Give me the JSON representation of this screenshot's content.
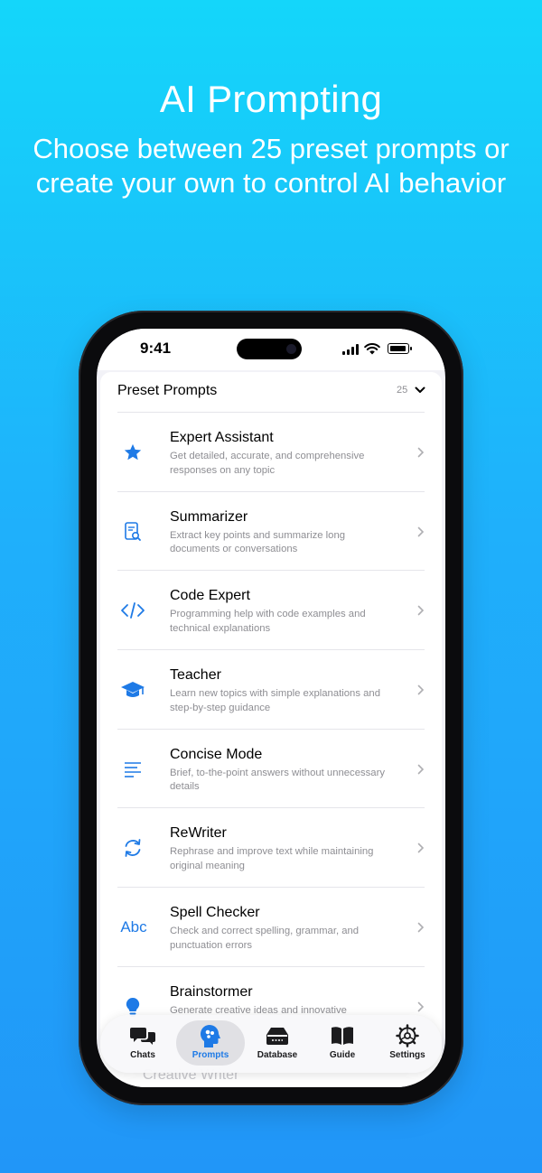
{
  "hero": {
    "title": "AI Prompting",
    "subtitle": "Choose between 25 preset prompts or create your own to control AI behavior"
  },
  "status_bar": {
    "time": "9:41"
  },
  "preset_section": {
    "title": "Preset Prompts",
    "count": "25"
  },
  "prompts": [
    {
      "icon": "star-icon",
      "name": "Expert Assistant",
      "description": "Get detailed, accurate, and comprehensive responses on any topic"
    },
    {
      "icon": "document-search-icon",
      "name": "Summarizer",
      "description": "Extract key points and summarize long documents or conversations"
    },
    {
      "icon": "code-brackets-icon",
      "name": "Code Expert",
      "description": "Programming help with code examples and technical explanations"
    },
    {
      "icon": "graduation-cap-icon",
      "name": "Teacher",
      "description": "Learn new topics with simple explanations and step-by-step guidance"
    },
    {
      "icon": "text-lines-icon",
      "name": "Concise Mode",
      "description": "Brief, to-the-point answers without unnecessary details"
    },
    {
      "icon": "rotate-arrows-icon",
      "name": "ReWriter",
      "description": "Rephrase and improve text while maintaining original meaning"
    },
    {
      "icon": "abc-text-icon",
      "name": "Spell Checker",
      "description": "Check and correct spelling, grammar, and punctuation errors"
    },
    {
      "icon": "lightbulb-icon",
      "name": "Brainstormer",
      "description": "Generate creative ideas and innovative"
    }
  ],
  "partial_row": {
    "name": "Creative Writer"
  },
  "tabs": [
    {
      "label": "Chats",
      "icon": "chat-bubbles-icon",
      "active": false
    },
    {
      "label": "Prompts",
      "icon": "brain-head-icon",
      "active": true
    },
    {
      "label": "Database",
      "icon": "database-icon",
      "active": false
    },
    {
      "label": "Guide",
      "icon": "book-icon",
      "active": false
    },
    {
      "label": "Settings",
      "icon": "gear-icon",
      "active": false
    }
  ],
  "colors": {
    "accent": "#1e7ae6",
    "background_top": "#14d6fa",
    "background_bottom": "#2196f8"
  },
  "abc_label": "Abc"
}
